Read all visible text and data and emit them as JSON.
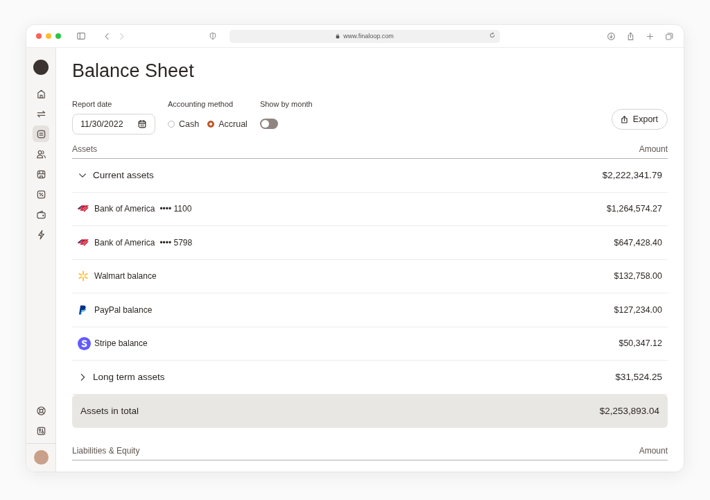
{
  "browser": {
    "url": "www.finaloop.com"
  },
  "sidebar": {
    "items": [
      {
        "kind": "home",
        "selected": false
      },
      {
        "kind": "transfer",
        "selected": false
      },
      {
        "kind": "document",
        "selected": true
      },
      {
        "kind": "people",
        "selected": false
      },
      {
        "kind": "store",
        "selected": false
      },
      {
        "kind": "percent",
        "selected": false
      },
      {
        "kind": "wallet",
        "selected": false
      },
      {
        "kind": "bolt",
        "selected": false
      }
    ],
    "bottom_items": [
      {
        "kind": "lifebuoy",
        "selected": false
      },
      {
        "kind": "sliders",
        "selected": false
      }
    ]
  },
  "page": {
    "title": "Balance Sheet"
  },
  "filters": {
    "report_date": {
      "label": "Report date",
      "value": "11/30/2022"
    },
    "accounting_method": {
      "label": "Accounting method",
      "options": [
        {
          "label": "Cash",
          "selected": false
        },
        {
          "label": "Accrual",
          "selected": true
        }
      ]
    },
    "show_by_month": {
      "label": "Show by month",
      "on": false
    },
    "export_button": "Export"
  },
  "assets": {
    "columns": [
      "Assets",
      "Amount"
    ],
    "rows": [
      {
        "kind": "group",
        "name": "Current assets",
        "amount": "$2,222,341.79",
        "expanded": true
      },
      {
        "kind": "account",
        "logo": {
          "kind": "stripes"
        },
        "name": "Bank of America",
        "mask": "•••• 1100",
        "amount": "$1,264,574.27"
      },
      {
        "kind": "account",
        "logo": {
          "kind": "stripes"
        },
        "name": "Bank of America",
        "mask": "•••• 5798",
        "amount": "$647,428.40"
      },
      {
        "kind": "account",
        "logo": {
          "kind": "spark"
        },
        "name": "Walmart balance",
        "amount": "$132,758.00"
      },
      {
        "kind": "account",
        "logo": {
          "kind": "p"
        },
        "name": "PayPal balance",
        "amount": "$127,234.00"
      },
      {
        "kind": "account",
        "logo": {
          "kind": "s"
        },
        "name": "Stripe balance",
        "amount": "$50,347.12"
      },
      {
        "kind": "group",
        "name": "Long term assets",
        "amount": "$31,524.25",
        "expanded": false
      },
      {
        "kind": "total",
        "name": "Assets in total",
        "amount": "$2,253,893.04"
      }
    ]
  },
  "liabilities": {
    "columns": [
      "Liabilities & Equity",
      "Amount"
    ]
  }
}
